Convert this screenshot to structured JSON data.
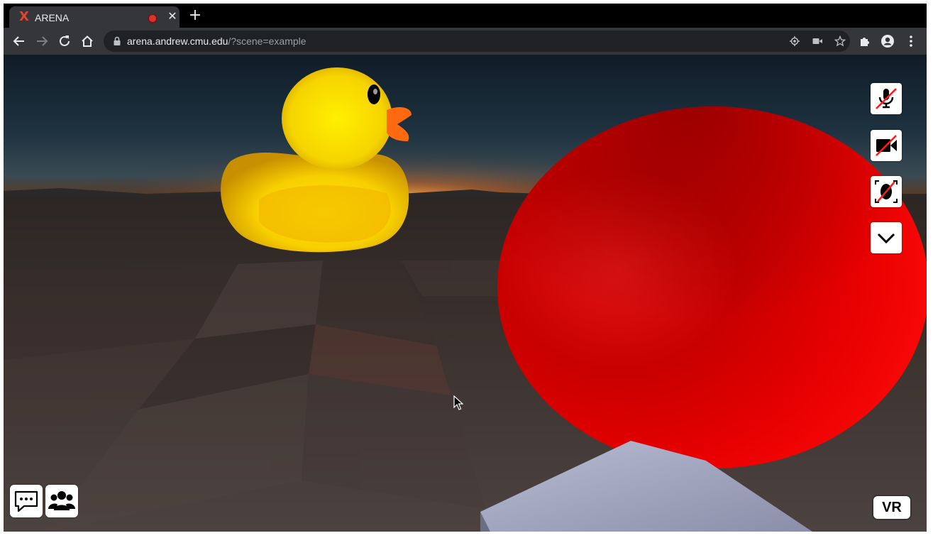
{
  "browser": {
    "tab": {
      "favicon": "X",
      "title": "ARENA",
      "recording_indicator": "recording-dot",
      "close_glyph": "✕"
    },
    "new_tab_glyph": "+",
    "toolbar": {
      "back_icon": "back-arrow-icon",
      "forward_icon": "forward-arrow-icon",
      "reload_icon": "reload-icon",
      "home_icon": "home-icon",
      "url_host": "arena.andrew.cmu.edu",
      "url_path": "/?scene=example",
      "omnibox_icons": [
        "location-icon",
        "camera-icon",
        "star-icon"
      ],
      "extension_icons": [
        "puzzle-icon",
        "profile-icon",
        "menu-dots-icon"
      ]
    }
  },
  "scene": {
    "objects": [
      "rubber-duck",
      "red-sphere",
      "grey-box",
      "ground-floor",
      "sunset-sky"
    ],
    "right_controls": [
      {
        "name": "mic-muted",
        "state": "off"
      },
      {
        "name": "camera-off",
        "state": "off"
      },
      {
        "name": "avatar-face-off",
        "state": "off"
      },
      {
        "name": "expand-more",
        "state": "collapsed"
      }
    ],
    "bottom_left_controls": [
      "chat",
      "users"
    ],
    "vr_label": "VR"
  },
  "colors": {
    "tabstrip": "#000000",
    "toolbar": "#35363a",
    "omnibox": "#202124",
    "accent_red": "#e0302a",
    "sphere": "#ff0000",
    "duck": "#ffd800"
  }
}
